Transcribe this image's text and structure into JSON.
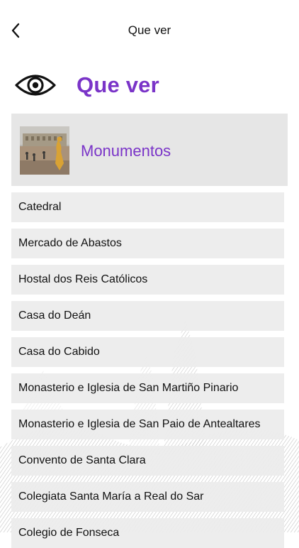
{
  "theme": {
    "accent": "#7a34c8",
    "row_bg": "#ececec",
    "card_bg": "#e6e6e6"
  },
  "navbar": {
    "title": "Que ver",
    "back_icon": "chevron-left-icon"
  },
  "header": {
    "icon": "eye-icon",
    "title": "Que ver"
  },
  "category": {
    "label": "Monumentos",
    "thumbnail": "plaza-photo"
  },
  "items": [
    {
      "label": "Catedral"
    },
    {
      "label": "Mercado de Abastos"
    },
    {
      "label": "Hostal dos Reis Católicos"
    },
    {
      "label": "Casa do Deán"
    },
    {
      "label": "Casa do Cabido"
    },
    {
      "label": "Monasterio e Iglesia de San Martiño Pinario"
    },
    {
      "label": "Monasterio e Iglesia de San Paio de Antealtares"
    },
    {
      "label": "Convento de Santa Clara"
    },
    {
      "label": "Colegiata Santa María a Real do Sar"
    },
    {
      "label": "Colegio de Fonseca"
    }
  ]
}
